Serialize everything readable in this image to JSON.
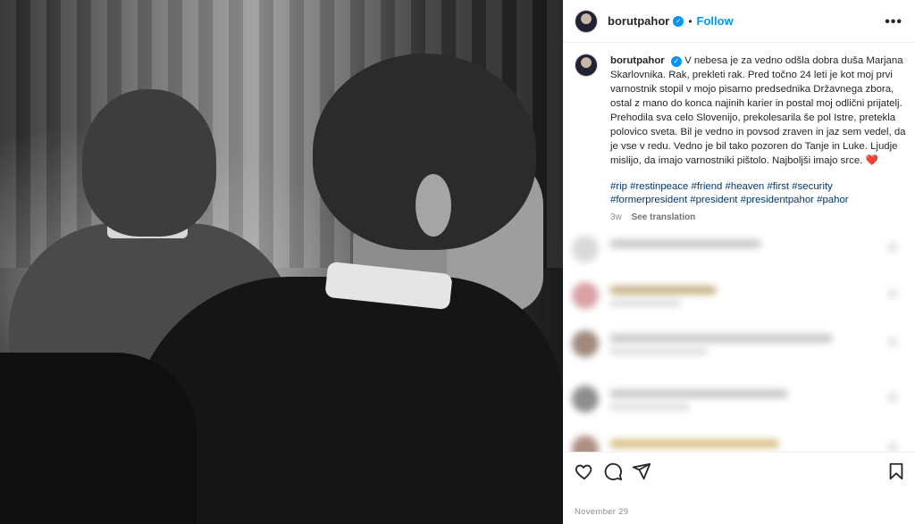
{
  "post": {
    "username": "borutpahor",
    "separator": "•",
    "follow_label": "Follow",
    "more_label": "•••"
  },
  "caption": {
    "username": "borutpahor",
    "text": "V nebesa je za vedno odšla dobra duša Marjana Skarlovnika. Rak, prekleti rak. Pred točno 24 leti je kot moj prvi varnostnik stopil v mojo pisarno predsednika Državnega zbora, ostal z mano do konca najinih karier in postal moj odlični prijatelj. Prehodila sva celo Slovenijo, prekolesarila še pol Istre, pretekla polovico sveta. Bil je vedno in povsod zraven in jaz sem vedel, da je vse v redu. Vedno je bil tako pozoren do Tanje in Luke. Ljudje mislijo, da imajo varnostniki pištolo. Najboljši imajo srce.",
    "emoji": "❤️",
    "hashtags": "#rip #restinpeace #friend #heaven #first #security #formerpresident #president #presidentpahor #pahor",
    "age": "3w",
    "see_translation": "See translation"
  },
  "footer": {
    "date": "November 29"
  },
  "icons": {
    "verified": "verified-badge-icon",
    "like": "heart-outline-icon",
    "comment": "comment-bubble-icon",
    "share": "paper-plane-icon",
    "save": "bookmark-icon",
    "more": "more-options-icon"
  },
  "colors": {
    "accent": "#0095f6",
    "hashtag": "#00376b",
    "muted": "#8e8e8e",
    "heart": "#ed1c24"
  }
}
